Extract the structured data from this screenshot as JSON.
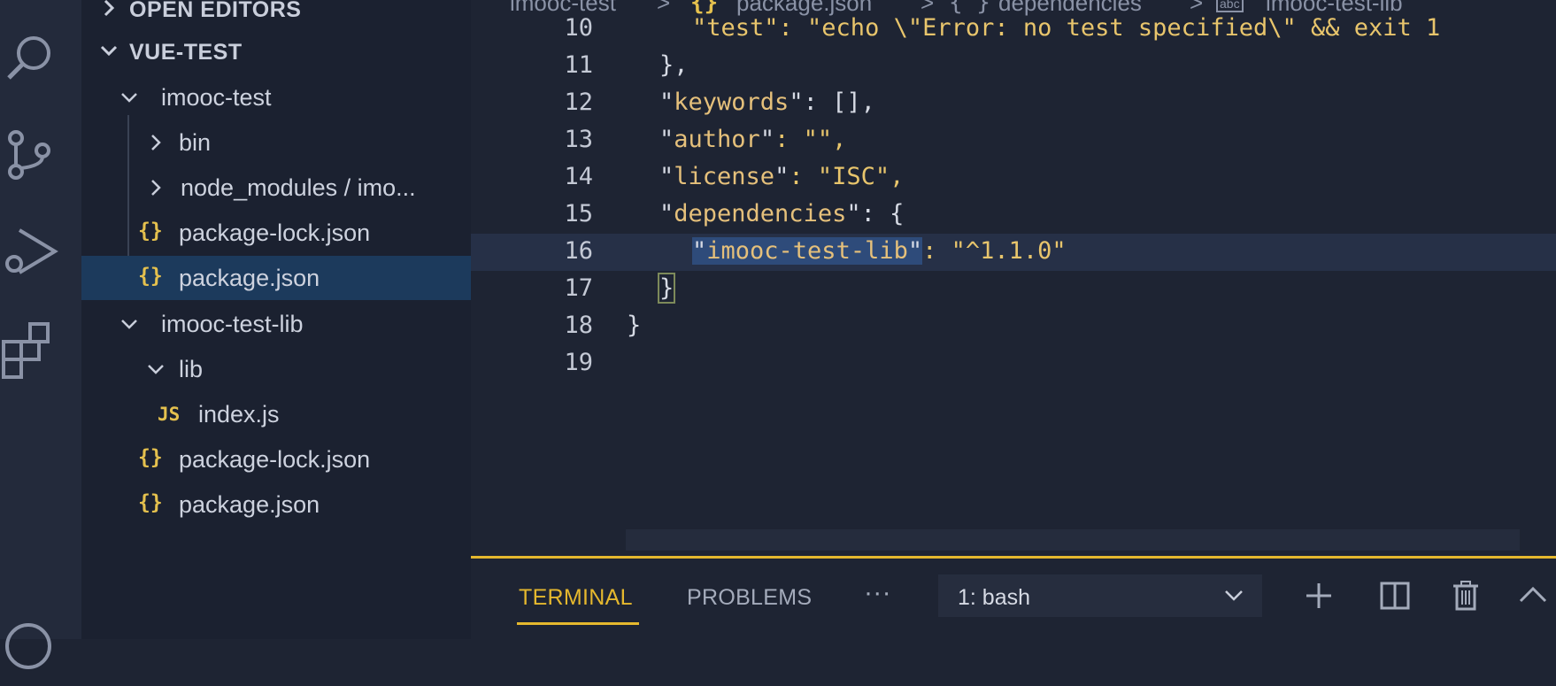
{
  "sidebar": {
    "open_editors_label": "OPEN EDITORS",
    "workspace_label": "VUE-TEST",
    "tree": [
      {
        "label": "imooc-test"
      },
      {
        "label": "bin"
      },
      {
        "label": "node_modules / imo..."
      },
      {
        "label": "package-lock.json",
        "icon": "{}"
      },
      {
        "label": "package.json",
        "icon": "{}"
      },
      {
        "label": "imooc-test-lib"
      },
      {
        "label": "lib"
      },
      {
        "label": "index.js",
        "icon": "JS"
      },
      {
        "label": "package-lock.json",
        "icon": "{}"
      },
      {
        "label": "package.json",
        "icon": "{}"
      }
    ]
  },
  "breadcrumb": {
    "items": [
      "imooc-test",
      "package.json",
      "dependencies",
      "imooc-test-lib"
    ],
    "separator": ">",
    "json_icon": "{}",
    "object_icon": "{ }",
    "string_icon": "abc"
  },
  "editor": {
    "lines": [
      {
        "num": "10",
        "text": "\"test\": \"echo \\\"Error: no test specified\\\" && exit 1"
      },
      {
        "num": "11",
        "text": "},"
      },
      {
        "num": "12",
        "key": "keywords",
        "rest": ": [],"
      },
      {
        "num": "13",
        "key": "author",
        "rest": ": \"\","
      },
      {
        "num": "14",
        "key": "license",
        "rest": ": \"ISC\","
      },
      {
        "num": "15",
        "key": "dependencies",
        "rest": ": {"
      },
      {
        "num": "16",
        "key": "imooc-test-lib",
        "rest": ": \"^1.1.0\""
      },
      {
        "num": "17",
        "text": "}"
      },
      {
        "num": "18",
        "text": "}"
      },
      {
        "num": "19",
        "text": ""
      }
    ]
  },
  "panel": {
    "tabs": [
      "TERMINAL",
      "PROBLEMS"
    ],
    "more": "···",
    "terminal_select": "1: bash"
  },
  "colors": {
    "accent": "#e5b82e",
    "selection": "#1c3a5c",
    "json_key": "#e5c07b"
  }
}
